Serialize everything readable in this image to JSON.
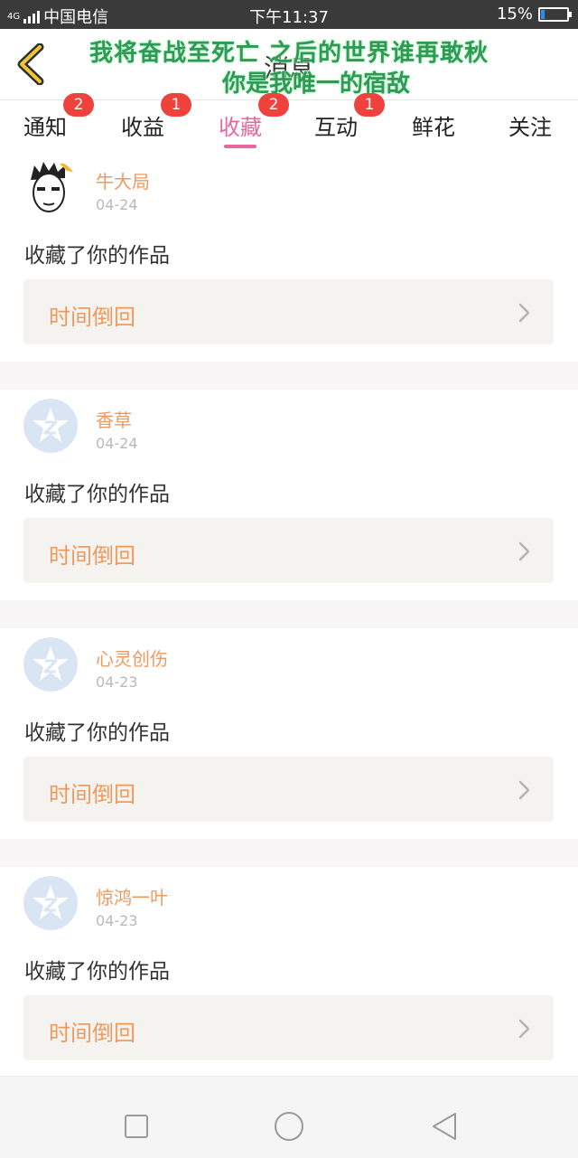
{
  "status_bar": {
    "network": "4G",
    "carrier": "中国电信",
    "time": "下午11:37",
    "battery": "15%",
    "battery_level": 0.15,
    "battery_color": "#2d8cf0"
  },
  "header": {
    "title": "消息",
    "back_icon": "chevron-left-icon",
    "overlay_line1": "我将奋战至死亡 之后的世界谁再敢秋",
    "overlay_line2": "你是我唯一的宿敌"
  },
  "tabs": [
    {
      "label": "通知",
      "badge": "2",
      "active": false
    },
    {
      "label": "收益",
      "badge": "1",
      "active": false
    },
    {
      "label": "收藏",
      "badge": "2",
      "active": true
    },
    {
      "label": "互动",
      "badge": "1",
      "active": false
    },
    {
      "label": "鲜花",
      "badge": null,
      "active": false
    },
    {
      "label": "关注",
      "badge": null,
      "active": false
    }
  ],
  "colors": {
    "accent": "#e8679e",
    "username": "#ee9a5f",
    "badge": "#f0423d",
    "card_inner": "#f4f3ef"
  },
  "feed": [
    {
      "user": "牛大局",
      "date": "04-24",
      "avatar": "cartoon-face-avatar",
      "action": "收藏了你的作品",
      "work_title": "时间倒回"
    },
    {
      "user": "香草",
      "date": "04-24",
      "avatar": "default-z-avatar",
      "action": "收藏了你的作品",
      "work_title": "时间倒回"
    },
    {
      "user": "心灵创伤",
      "date": "04-23",
      "avatar": "default-z-avatar",
      "action": "收藏了你的作品",
      "work_title": "时间倒回"
    },
    {
      "user": "惊鸿一叶",
      "date": "04-23",
      "avatar": "default-z-avatar",
      "action": "收藏了你的作品",
      "work_title": "时间倒回"
    }
  ],
  "nav_bar": {
    "buttons": [
      "square-icon",
      "circle-icon",
      "triangle-back-icon"
    ]
  }
}
